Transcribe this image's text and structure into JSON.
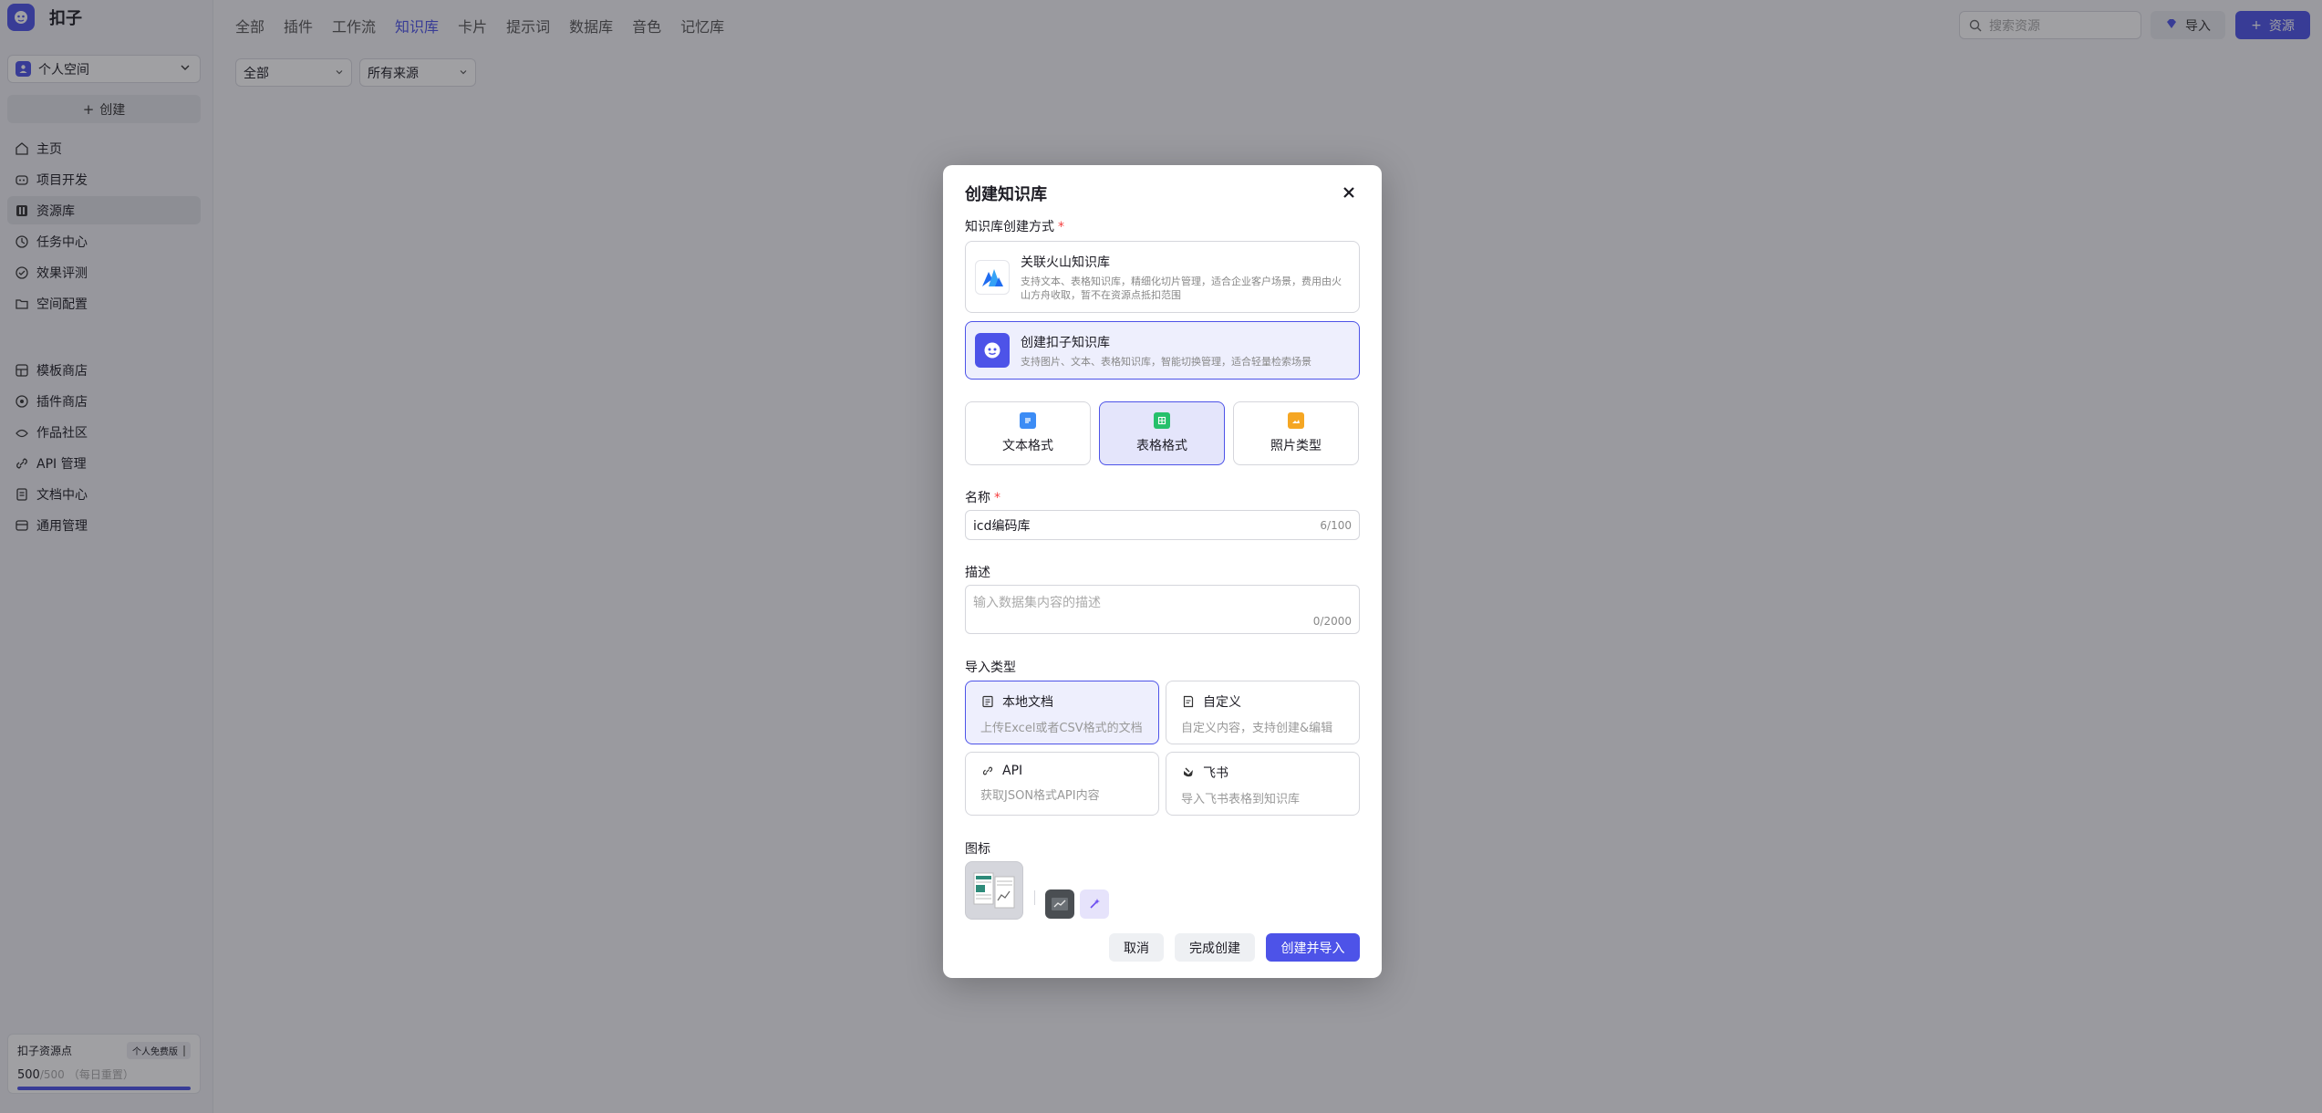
{
  "app": {
    "name": "扣子"
  },
  "sidebar": {
    "space_select": "个人空间",
    "create_label": "创建",
    "items_top": [
      {
        "label": "主页",
        "icon": "home-icon"
      },
      {
        "label": "项目开发",
        "icon": "project-icon"
      },
      {
        "label": "资源库",
        "icon": "library-icon",
        "active": true
      },
      {
        "label": "任务中心",
        "icon": "task-icon"
      },
      {
        "label": "效果评测",
        "icon": "evaluation-icon"
      },
      {
        "label": "空间配置",
        "icon": "folder-icon"
      }
    ],
    "items_bottom": [
      {
        "label": "模板商店",
        "icon": "template-icon"
      },
      {
        "label": "插件商店",
        "icon": "plugin-icon"
      },
      {
        "label": "作品社区",
        "icon": "community-icon"
      },
      {
        "label": "API 管理",
        "icon": "api-icon"
      },
      {
        "label": "文档中心",
        "icon": "doc-icon"
      },
      {
        "label": "通用管理",
        "icon": "manage-icon"
      }
    ],
    "quota": {
      "title": "扣子资源点",
      "plan": "个人免费版",
      "value": "500",
      "total": "/500",
      "note": "（每日重置）",
      "progress": 1.0
    }
  },
  "topbar": {
    "tabs": [
      {
        "label": "全部"
      },
      {
        "label": "插件"
      },
      {
        "label": "工作流"
      },
      {
        "label": "知识库",
        "active": true
      },
      {
        "label": "卡片"
      },
      {
        "label": "提示词"
      },
      {
        "label": "数据库"
      },
      {
        "label": "音色"
      },
      {
        "label": "记忆库"
      }
    ],
    "filter_type": "全部",
    "filter_source": "所有来源",
    "search_placeholder": "搜索资源",
    "import_label": "导入",
    "resource_label": "资源"
  },
  "modal": {
    "title": "创建知识库",
    "method_label": "知识库创建方式",
    "required_mark": "*",
    "options": [
      {
        "title": "关联火山知识库",
        "desc": "支持文本、表格知识库，精细化切片管理，适合企业客户场景，费用由火山方舟收取，暂不在资源点抵扣范围",
        "selected": false
      },
      {
        "title": "创建扣子知识库",
        "desc": "支持图片、文本、表格知识库，智能切换管理，适合轻量检索场景",
        "selected": true
      }
    ],
    "formats": [
      {
        "label": "文本格式",
        "icon": "text-format-icon",
        "color": "#3c8cf5"
      },
      {
        "label": "表格格式",
        "icon": "table-format-icon",
        "color": "#26c06b",
        "selected": true
      },
      {
        "label": "照片类型",
        "icon": "image-format-icon",
        "color": "#f5a623"
      }
    ],
    "name_label": "名称",
    "name_value": "icd编码库",
    "name_counter": "6/100",
    "desc_label": "描述",
    "desc_placeholder": "输入数据集内容的描述",
    "desc_counter": "0/2000",
    "import_label": "导入类型",
    "import_types": [
      {
        "title": "本地文档",
        "desc": "上传Excel或者CSV格式的文档",
        "icon": "local-doc-icon",
        "selected": true
      },
      {
        "title": "自定义",
        "desc": "自定义内容，支持创建&编辑",
        "icon": "custom-doc-icon"
      },
      {
        "title": "API",
        "desc": "获取JSON格式API内容",
        "icon": "link-icon"
      },
      {
        "title": "飞书",
        "desc": "导入飞书表格到知识库",
        "icon": "feishu-icon"
      }
    ],
    "icon_label": "图标",
    "cancel_label": "取消",
    "done_label": "完成创建",
    "create_import_label": "创建并导入"
  }
}
